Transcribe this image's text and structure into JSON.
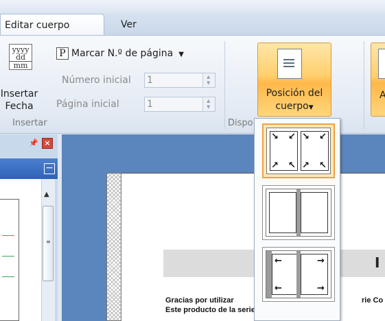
{
  "tabs": [
    {
      "label": "Editar cuerpo",
      "active": true
    },
    {
      "label": "Ver",
      "active": false
    }
  ],
  "ribbon": {
    "insert_group": {
      "label": "Insertar",
      "date_icon_lines": [
        "yyyy",
        "dd",
        "mm"
      ],
      "date_button_label_1": "Insertar",
      "date_button_label_2": "Fecha",
      "page_number_icon": "P",
      "mark_page_number_label": "Marcar N.º de página",
      "start_number_label": "Número inicial",
      "start_number_value": "1",
      "start_page_label": "Página inicial",
      "start_page_value": "1"
    },
    "disposition_group": {
      "label": "Dispo",
      "body_position_label_1": "Posición del",
      "body_position_label_2": "cuerpo",
      "next_button_label": "A"
    }
  },
  "dropdown": {
    "options": [
      {
        "name": "corners",
        "selected": true
      },
      {
        "name": "plain",
        "selected": false
      },
      {
        "name": "sides",
        "selected": false
      }
    ]
  },
  "document": {
    "title_visible": "I",
    "line1_left": "Gracias por utilizar",
    "line1_right": "rie Co",
    "line2": "Este producto de la serie Comosoft GD es una"
  },
  "colors": {
    "accent_orange": "#ffcf6d",
    "pane_header": "#2f62b6",
    "canvas_blue": "#5b86bd"
  }
}
